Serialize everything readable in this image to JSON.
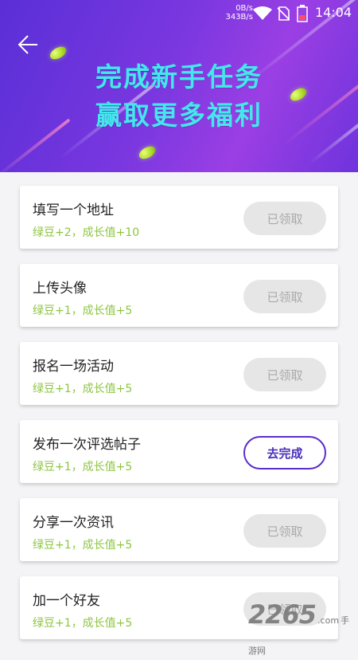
{
  "status_bar": {
    "net_down": "0B/s",
    "net_up": "343B/s",
    "time": "14:04"
  },
  "banner": {
    "title_line1": "完成新手任务",
    "title_line2": "赢取更多福利"
  },
  "tasks": [
    {
      "name": "填写一个地址",
      "reward": "绿豆+2，成长值+10",
      "button": "已领取",
      "state": "done"
    },
    {
      "name": "上传头像",
      "reward": "绿豆+1，成长值+5",
      "button": "已领取",
      "state": "done"
    },
    {
      "name": "报名一场活动",
      "reward": "绿豆+1，成长值+5",
      "button": "已领取",
      "state": "done"
    },
    {
      "name": "发布一次评选帖子",
      "reward": "绿豆+1，成长值+5",
      "button": "去完成",
      "state": "todo"
    },
    {
      "name": "分享一次资讯",
      "reward": "绿豆+1，成长值+5",
      "button": "已领取",
      "state": "done"
    },
    {
      "name": "加一个好友",
      "reward": "绿豆+1，成长值+5",
      "button": "已领取",
      "state": "done"
    }
  ],
  "watermark": {
    "number": "2265",
    "suffix": ".com",
    "label": "手游网"
  },
  "colors": {
    "accent": "#5a2fc9",
    "reward_green": "#8cc63f",
    "title_cyan": "#43e8ec"
  }
}
